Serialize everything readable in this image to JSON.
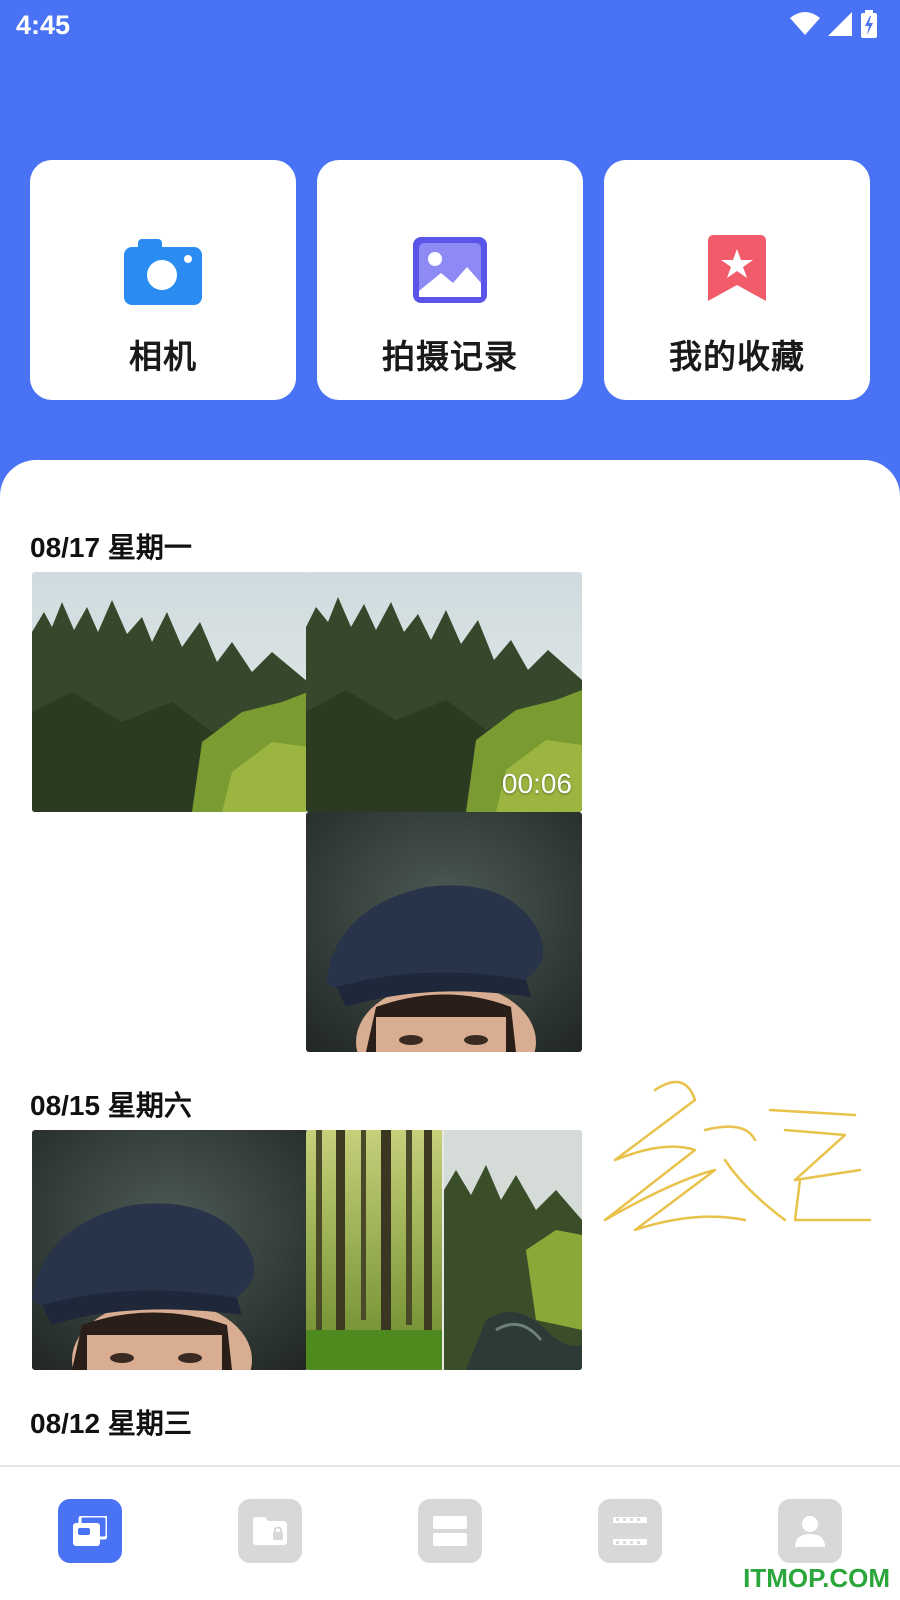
{
  "status_bar": {
    "time": "4:45"
  },
  "quick_actions": [
    {
      "label": "相机",
      "icon": "camera-icon",
      "color": "#2a8cf0"
    },
    {
      "label": "拍摄记录",
      "icon": "gallery-icon",
      "color": "#5a55e8"
    },
    {
      "label": "我的收藏",
      "icon": "favorite-icon",
      "color": "#f25b6a"
    }
  ],
  "sections": [
    {
      "date": "08/17 星期一",
      "items": [
        {
          "kind": "photo",
          "subject": "forest"
        },
        {
          "kind": "video",
          "subject": "forest",
          "duration": "00:06"
        },
        {
          "kind": "photo",
          "subject": "portrait"
        }
      ]
    },
    {
      "date": "08/15 星期六",
      "items": [
        {
          "kind": "photo",
          "subject": "portrait"
        },
        {
          "kind": "photo",
          "subject": "forest-collage"
        }
      ]
    },
    {
      "date": "08/12 星期三",
      "items": []
    }
  ],
  "bottom_nav": [
    {
      "icon": "album-icon",
      "active": true
    },
    {
      "icon": "locked-folder-icon",
      "active": false
    },
    {
      "icon": "list-icon",
      "active": false
    },
    {
      "icon": "film-icon",
      "active": false
    },
    {
      "icon": "profile-icon",
      "active": false
    }
  ],
  "watermark": "ITMOP.COM",
  "colors": {
    "primary": "#4a72f5",
    "nav_inactive": "#d8d8d8"
  }
}
